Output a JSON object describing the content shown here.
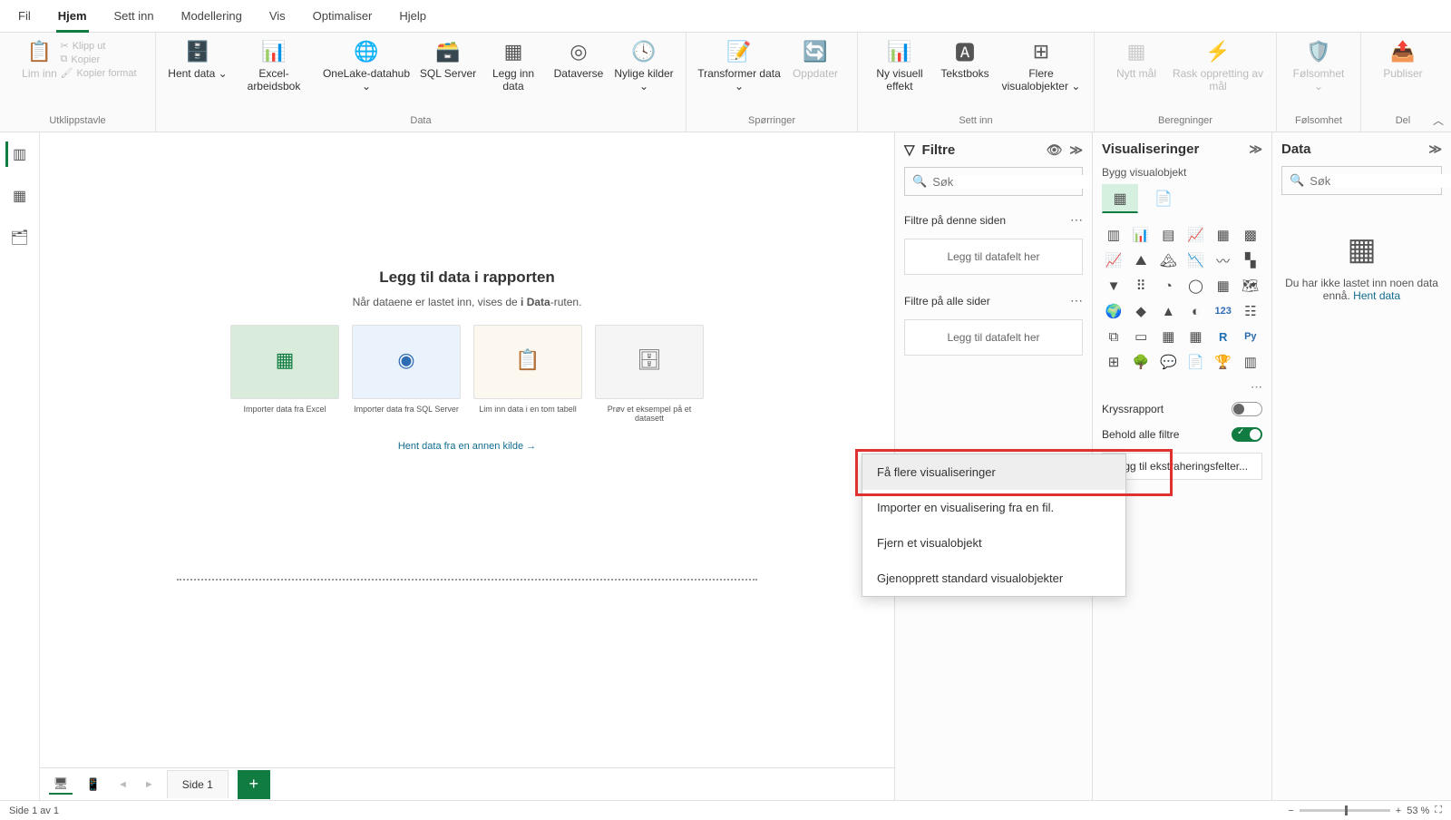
{
  "tabs": {
    "fil": "Fil",
    "hjem": "Hjem",
    "settinn": "Sett inn",
    "modellering": "Modellering",
    "vis": "Vis",
    "optimaliser": "Optimaliser",
    "hjelp": "Hjelp"
  },
  "ribbon": {
    "clipboard": {
      "limin": "Lim inn",
      "klippUt": "Klipp ut",
      "kopier": "Kopier",
      "kopierFormat": "Kopier format",
      "group": "Utklippstavle"
    },
    "data": {
      "hentData": "Hent data ⌄",
      "excel": "Excel-arbeidsbok",
      "onelake": "OneLake-datahub ⌄",
      "sql": "SQL Server",
      "leggInn": "Legg inn data",
      "dataverse": "Dataverse",
      "nylige": "Nylige kilder ⌄",
      "group": "Data"
    },
    "queries": {
      "transformer": "Transformer data ⌄",
      "oppdater": "Oppdater",
      "group": "Spørringer"
    },
    "insert": {
      "nyVisuell": "Ny visuell effekt",
      "tekstboks": "Tekstboks",
      "flere": "Flere visualobjekter ⌄",
      "group": "Sett inn"
    },
    "calc": {
      "nyttMal": "Nytt mål",
      "rask": "Rask oppretting av mål",
      "group": "Beregninger"
    },
    "sens": {
      "btn": "Følsomhet ⌄",
      "group": "Følsomhet"
    },
    "share": {
      "btn": "Publiser",
      "group": "Del"
    }
  },
  "canvasCenter": {
    "title": "Legg til data i rapporten",
    "subtitlePrefix": "Når dataene er lastet inn, vises de ",
    "subtitleBold": "i Data",
    "subtitleSuffix": "-ruten.",
    "cards": [
      "Importer data fra Excel",
      "Importer data fra SQL Server",
      "Lim inn data i en tom tabell",
      "Prøv et eksempel på et datasett"
    ],
    "otherLink": "Hent data fra en annen kilde →"
  },
  "filters": {
    "title": "Filtre",
    "searchPlaceholder": "Søk",
    "thisPage": "Filtre på denne siden",
    "allPages": "Filtre på alle sider",
    "dropzone": "Legg til datafelt her"
  },
  "viz": {
    "title": "Visualiseringer",
    "sub": "Bygg visualobjekt",
    "crossLabel": "Kryssrapport",
    "keepLabel": "Behold alle filtre",
    "extractBtn": "Legg til ekstraheringsfelter..."
  },
  "dataPane": {
    "title": "Data",
    "searchPlaceholder": "Søk",
    "emptyPrefix": "Du har ikke lastet inn noen data ennå. ",
    "emptyLink": "Hent data"
  },
  "ctx": {
    "m1": "Få flere visualiseringer",
    "m2": "Importer en visualisering fra en fil.",
    "m3": "Fjern et visualobjekt",
    "m4": "Gjenopprett standard visualobjekter"
  },
  "pagebar": {
    "page1": "Side 1"
  },
  "status": {
    "left": "Side 1 av 1",
    "zoom": "53 %"
  }
}
